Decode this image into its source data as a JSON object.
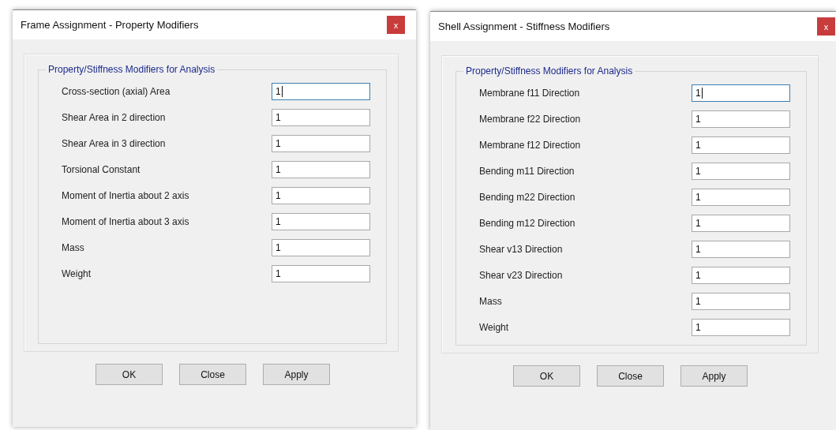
{
  "dialogs": [
    {
      "title": "Frame Assignment - Property Modifiers",
      "close": "x",
      "group": "Property/Stiffness Modifiers for Analysis",
      "fields": [
        {
          "label": "Cross-section (axial) Area",
          "value": "1",
          "focused": true
        },
        {
          "label": "Shear Area in 2 direction",
          "value": "1",
          "focused": false
        },
        {
          "label": "Shear Area in 3 direction",
          "value": "1",
          "focused": false
        },
        {
          "label": "Torsional Constant",
          "value": "1",
          "focused": false
        },
        {
          "label": "Moment of Inertia about 2 axis",
          "value": "1",
          "focused": false
        },
        {
          "label": "Moment of Inertia about 3 axis",
          "value": "1",
          "focused": false
        },
        {
          "label": "Mass",
          "value": "1",
          "focused": false
        },
        {
          "label": "Weight",
          "value": "1",
          "focused": false
        }
      ],
      "buttons": [
        "OK",
        "Close",
        "Apply"
      ]
    },
    {
      "title": "Shell Assignment - Stiffness Modifiers",
      "close": "x",
      "group": "Property/Stiffness Modifiers for Analysis",
      "fields": [
        {
          "label": "Membrane f11 Direction",
          "value": "1",
          "focused": true
        },
        {
          "label": "Membrane f22 Direction",
          "value": "1",
          "focused": false
        },
        {
          "label": "Membrane f12 Direction",
          "value": "1",
          "focused": false
        },
        {
          "label": "Bending m11 Direction",
          "value": "1",
          "focused": false
        },
        {
          "label": "Bending m22 Direction",
          "value": "1",
          "focused": false
        },
        {
          "label": "Bending m12 Direction",
          "value": "1",
          "focused": false
        },
        {
          "label": "Shear v13 Direction",
          "value": "1",
          "focused": false
        },
        {
          "label": "Shear v23 Direction",
          "value": "1",
          "focused": false
        },
        {
          "label": "Mass",
          "value": "1",
          "focused": false
        },
        {
          "label": "Weight",
          "value": "1",
          "focused": false
        }
      ],
      "buttons": [
        "OK",
        "Close",
        "Apply"
      ]
    }
  ]
}
